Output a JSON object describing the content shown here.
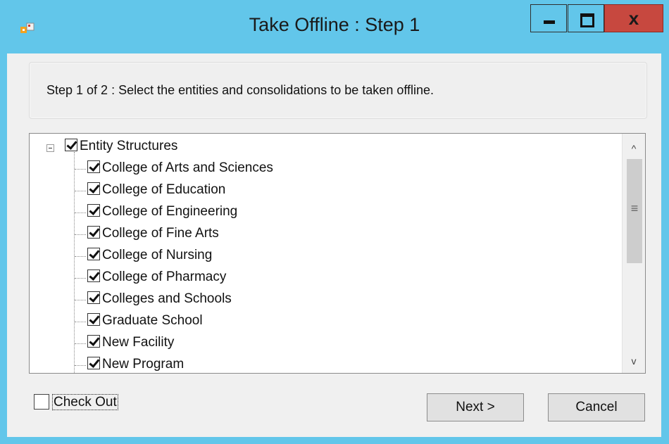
{
  "window": {
    "title": "Take Offline : Step 1",
    "close_glyph": "x"
  },
  "step_panel": {
    "text": "Step 1 of 2 : Select the entities and consolidations to be taken offline."
  },
  "tree": {
    "root": {
      "label": "Entity Structures",
      "checked": true,
      "expanded": true
    },
    "children": [
      {
        "label": "College of Arts and Sciences",
        "checked": true
      },
      {
        "label": "College of Education",
        "checked": true
      },
      {
        "label": "College of Engineering",
        "checked": true
      },
      {
        "label": "College of Fine Arts",
        "checked": true
      },
      {
        "label": "College of Nursing",
        "checked": true
      },
      {
        "label": "College of Pharmacy",
        "checked": true
      },
      {
        "label": "Colleges and Schools",
        "checked": true
      },
      {
        "label": "Graduate School",
        "checked": true
      },
      {
        "label": "New Facility",
        "checked": true
      },
      {
        "label": "New Program",
        "checked": true
      }
    ]
  },
  "scrollbar": {
    "up_glyph": "^",
    "down_glyph": "v",
    "grip_glyph": "≡"
  },
  "footer": {
    "checkout_label": "Check Out",
    "checkout_checked": false,
    "next_label": "Next >",
    "cancel_label": "Cancel"
  },
  "colors": {
    "titlebar": "#62c6ea",
    "close_button": "#c7483f",
    "client_bg": "#f0f0f0"
  }
}
